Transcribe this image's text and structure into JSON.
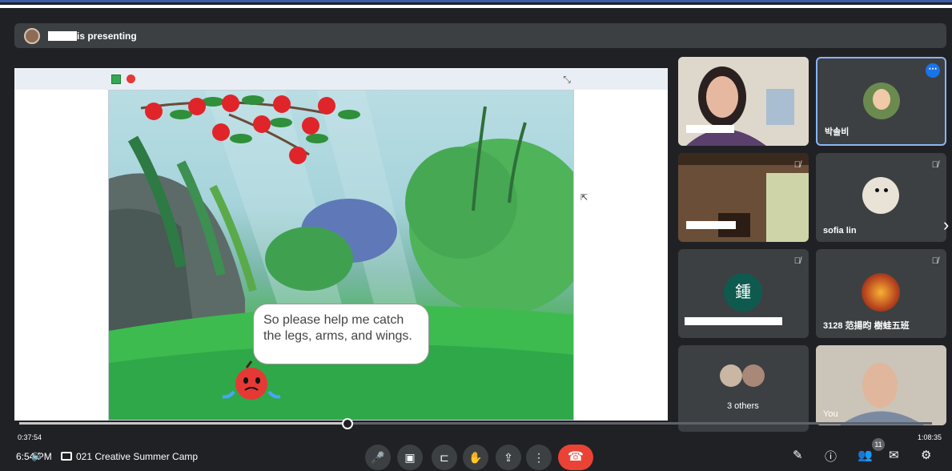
{
  "presenting": {
    "suffix": "is presenting"
  },
  "stage": {
    "bubble_line1": "So please help me catch",
    "bubble_line2": "the legs, arms, and wings."
  },
  "participants": {
    "tile2_name": "박솔비",
    "tile4_name": "sofia lin",
    "tile5_initial": "鍾",
    "tile6_name": "3128 范揚昀 樹蛙五班",
    "tile7_label": "3 others",
    "tile8_name": "You"
  },
  "playback": {
    "current": "0:37:54",
    "duration": "1:08:35",
    "progress": 0.36
  },
  "footer": {
    "clock": "6:54 PM",
    "meeting_title": "021 Creative Summer Camp",
    "people_count": "11"
  },
  "icons": {
    "mic": "mic-icon",
    "camera": "camera-icon",
    "captions": "captions-icon",
    "raise_hand": "raise-hand-icon",
    "present": "present-icon",
    "more": "more-options-icon",
    "end_call": "end-call-icon",
    "pen": "pen-icon"
  },
  "colors": {
    "end_call": "#ea4335",
    "active_speaker": "#8ab4f8",
    "more_button": "#1a73e8"
  }
}
